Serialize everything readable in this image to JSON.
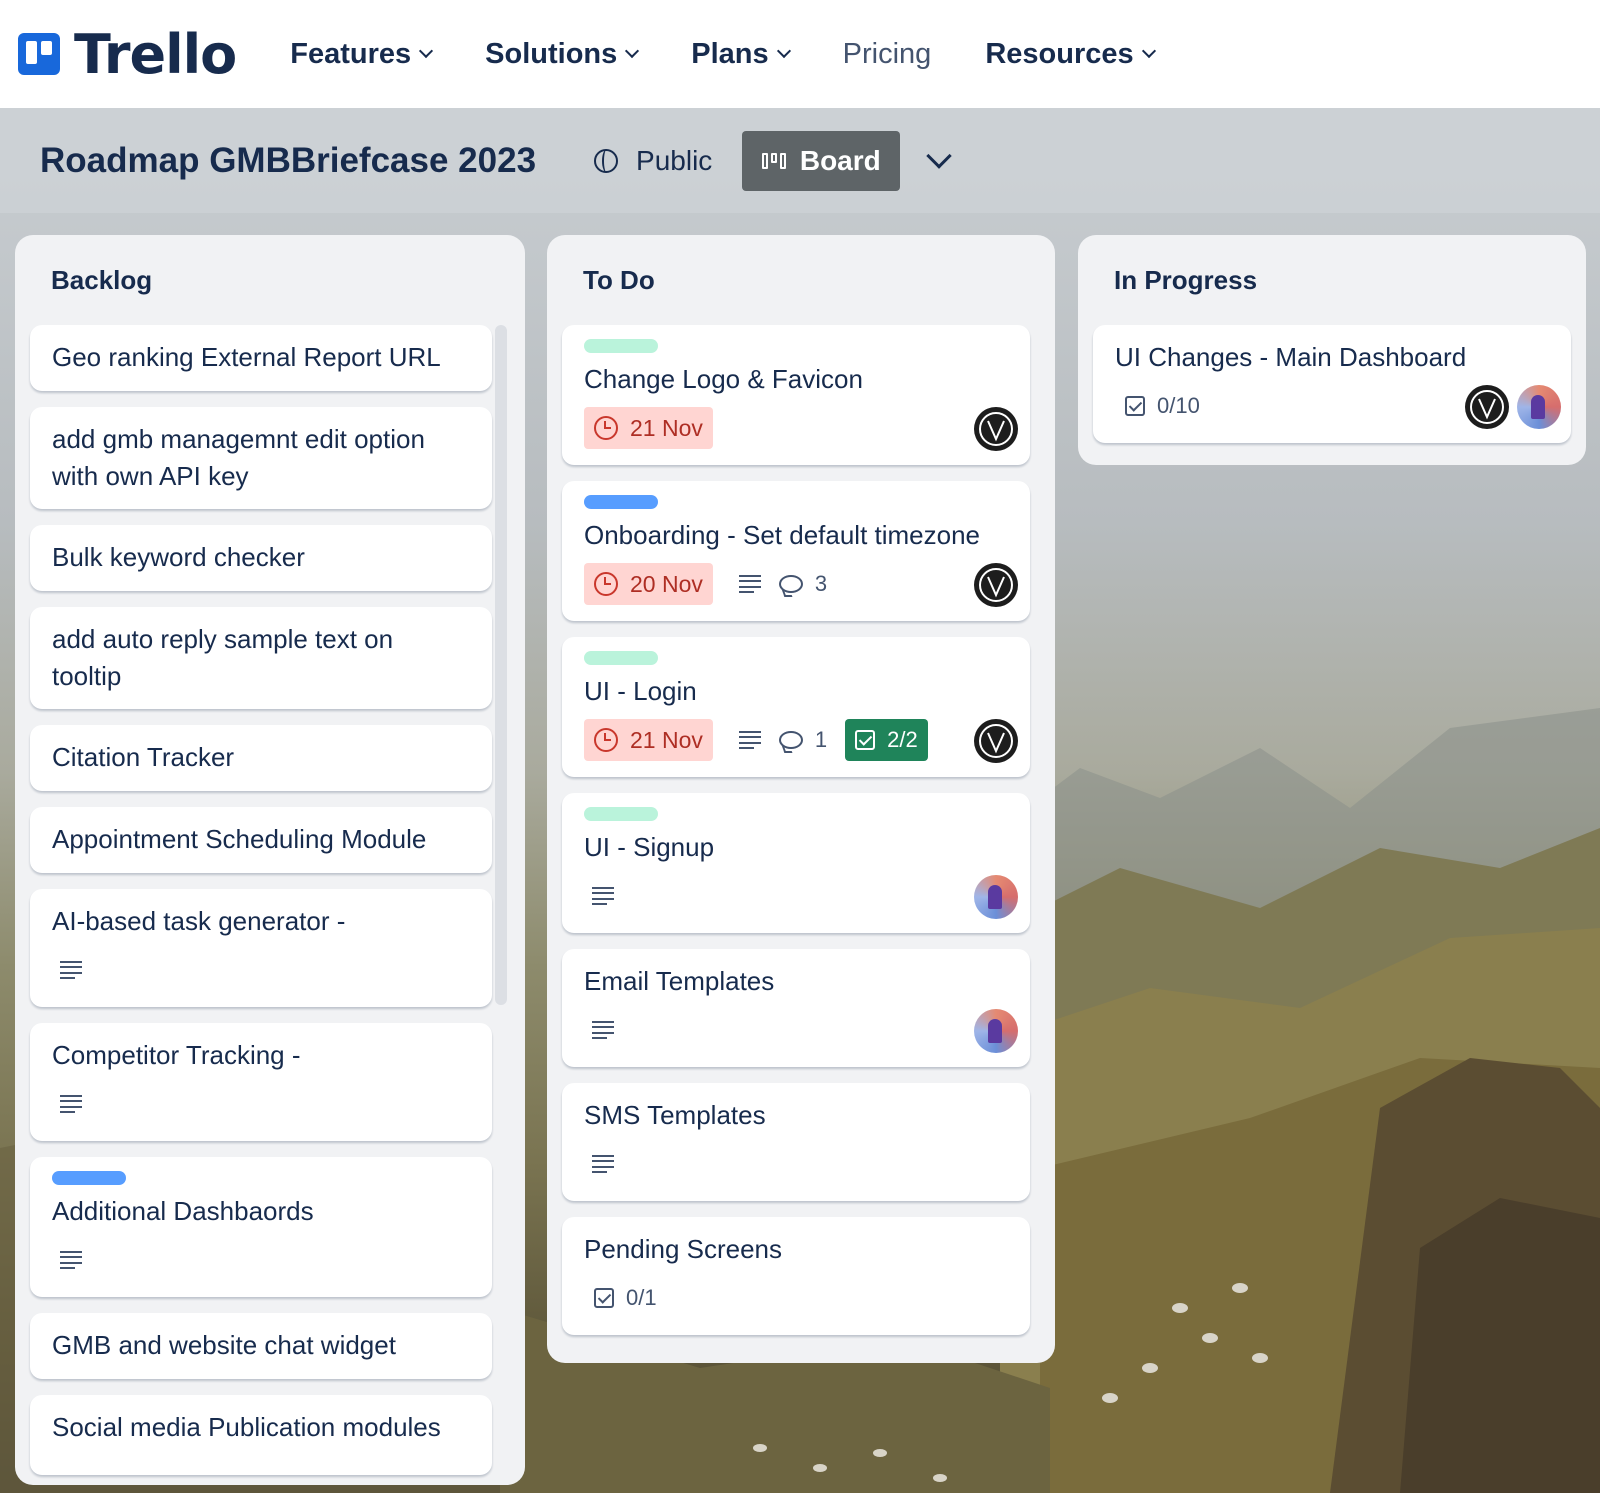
{
  "app": {
    "logo_text": "Trello"
  },
  "nav": {
    "items": [
      {
        "label": "Features",
        "dropdown": true
      },
      {
        "label": "Solutions",
        "dropdown": true
      },
      {
        "label": "Plans",
        "dropdown": true
      },
      {
        "label": "Pricing",
        "dropdown": false
      },
      {
        "label": "Resources",
        "dropdown": true
      }
    ]
  },
  "board": {
    "title": "Roadmap GMBBriefcase 2023",
    "visibility": "Public",
    "view_label": "Board"
  },
  "colors": {
    "brand_blue": "#1868db",
    "label_green": "#baf3db",
    "label_blue": "#579dff",
    "due_bg": "#ffd5d2",
    "checklist_done": "#1f845a"
  },
  "lists": [
    {
      "title": "Backlog",
      "cards": [
        {
          "title": "Geo ranking External Report URL"
        },
        {
          "title": "add gmb managemnt edit option with own API key"
        },
        {
          "title": "Bulk keyword checker"
        },
        {
          "title": "add auto reply sample text on tooltip"
        },
        {
          "title": "Citation Tracker"
        },
        {
          "title": "Appointment Scheduling Module"
        },
        {
          "title": "AI-based task generator -",
          "has_description": true
        },
        {
          "title": "Competitor Tracking -",
          "has_description": true
        },
        {
          "title": "Additional Dashbaords",
          "label_color": "blue",
          "has_description": true
        },
        {
          "title": "GMB and website chat widget"
        },
        {
          "title": "Social media Publication modules"
        }
      ]
    },
    {
      "title": "To Do",
      "cards": [
        {
          "title": "Change Logo & Favicon",
          "label_color": "green",
          "due": "21 Nov",
          "member": "dark-avatar"
        },
        {
          "title": "Onboarding - Set default timezone",
          "label_color": "blue",
          "due": "20 Nov",
          "has_description": true,
          "comments": "3",
          "member": "dark-avatar"
        },
        {
          "title": "UI - Login",
          "label_color": "green",
          "due": "21 Nov",
          "has_description": true,
          "comments": "1",
          "checklist": "2/2",
          "member": "dark-avatar"
        },
        {
          "title": "UI - Signup",
          "label_color": "green",
          "has_description": true,
          "member": "color-avatar"
        },
        {
          "title": "Email Templates",
          "has_description": true,
          "member": "color-avatar"
        },
        {
          "title": "SMS Templates",
          "has_description": true
        },
        {
          "title": "Pending Screens",
          "checklist": "0/1"
        }
      ]
    },
    {
      "title": "In Progress",
      "cards": [
        {
          "title": "UI Changes - Main Dashboard",
          "checklist": "0/10",
          "members": [
            "dark-avatar",
            "color-avatar"
          ]
        }
      ]
    }
  ]
}
